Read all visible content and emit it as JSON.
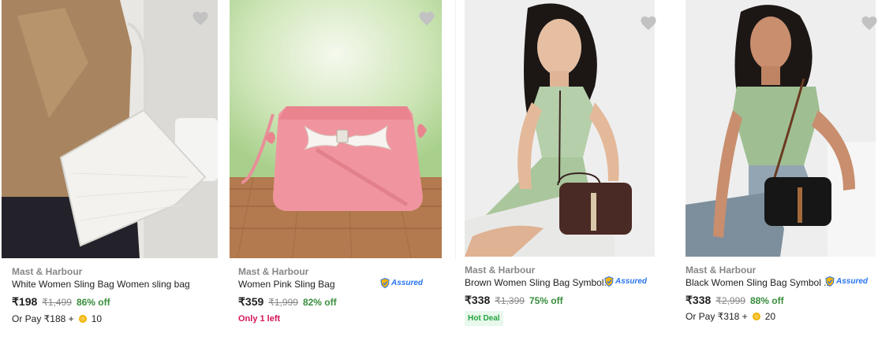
{
  "colors": {
    "price_green": "#388e3c",
    "assured_blue": "#2874f0",
    "alert_pink": "#d4145a",
    "hot_deal_green": "#26a541"
  },
  "products": [
    {
      "brand": "Mast & Harbour",
      "title": "White Women Sling Bag Women sling bag",
      "price": "₹198",
      "mrp": "₹1,499",
      "discount": "86% off",
      "or_pay_label": "Or Pay ₹188 +",
      "coins": "10",
      "image": "white-shoulder-bag-photo"
    },
    {
      "brand": "Mast & Harbour",
      "title": "Women Pink Sling Bag",
      "price": "₹359",
      "mrp": "₹1,999",
      "discount": "82% off",
      "assured": "Assured",
      "stock_note": "Only 1 left",
      "image": "pink-sling-bag-photo"
    },
    {
      "brand": "Mast & Harbour",
      "title": "Brown Women Sling Bag Symbol...",
      "price": "₹338",
      "mrp": "₹1,399",
      "discount": "75% off",
      "assured": "Assured",
      "badge": "Hot Deal",
      "image": "brown-sling-bag-model-photo"
    },
    {
      "brand": "Mast & Harbour",
      "title": "Black Women Sling Bag Symbol ...",
      "price": "₹338",
      "mrp": "₹2,999",
      "discount": "88% off",
      "assured": "Assured",
      "or_pay_label": "Or Pay ₹318 +",
      "coins": "20",
      "image": "black-sling-bag-model-photo"
    }
  ]
}
